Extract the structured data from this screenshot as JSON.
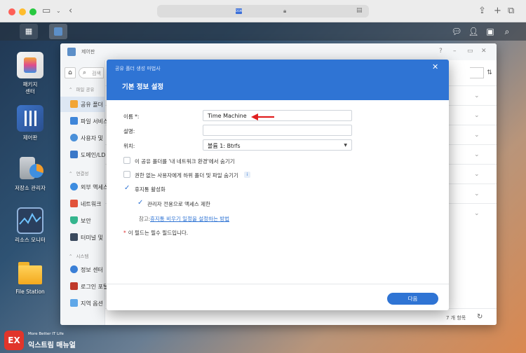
{
  "browser": {
    "favicon_text": "DSM"
  },
  "desktop_icons": [
    {
      "label": "패키지\n센터"
    },
    {
      "label": "제어판"
    },
    {
      "label": "저장소 관리자"
    },
    {
      "label": "리소스 모니터"
    },
    {
      "label": "File Station"
    }
  ],
  "control_panel": {
    "title": "제어판",
    "search_placeholder": "검색",
    "sections": {
      "file_sharing": "파일 공유",
      "connectivity": "연결성",
      "system": "시스템"
    },
    "items": [
      "공유 폴더",
      "파일 서비스",
      "사용자 및",
      "도메인/LD",
      "외부 액세스",
      "네트워크",
      "보안",
      "터미널 및",
      "정보 센터",
      "로그인 포털",
      "지역 옵션"
    ],
    "item_count": "7 개 항목"
  },
  "wizard": {
    "window_title": "공유 폴더 생성 마법사",
    "step_title": "기본 정보 설정",
    "name_label": "이름 *:",
    "name_value": "Time Machine",
    "desc_label": "설명:",
    "desc_value": "",
    "location_label": "위치:",
    "location_value": "볼륨 1:  Btrfs",
    "options": [
      {
        "label": "이 공유 폴더를 '내 네트워크 환경'에서 숨기기",
        "checked": false
      },
      {
        "label": "권한 없는 사용자에게 하위 폴더 및 파일 숨기기",
        "checked": false
      },
      {
        "label": "휴지통 활성화",
        "checked": true
      },
      {
        "label": "관리자 전용으로 액세스 제한",
        "checked": true
      }
    ],
    "note_prefix": "참고:",
    "note_link": "휴지통 비우기 일정을 설정하는 방법",
    "required_note": "이 필드는 필수 필드입니다.",
    "required_star": "*",
    "next_button": "다음"
  },
  "watermark": {
    "small": "More Better IT Life",
    "big": "익스트림 매뉴얼",
    "logo": "EX"
  },
  "colors": {
    "accent": "#2f74d4",
    "arrow": "#e02020"
  }
}
